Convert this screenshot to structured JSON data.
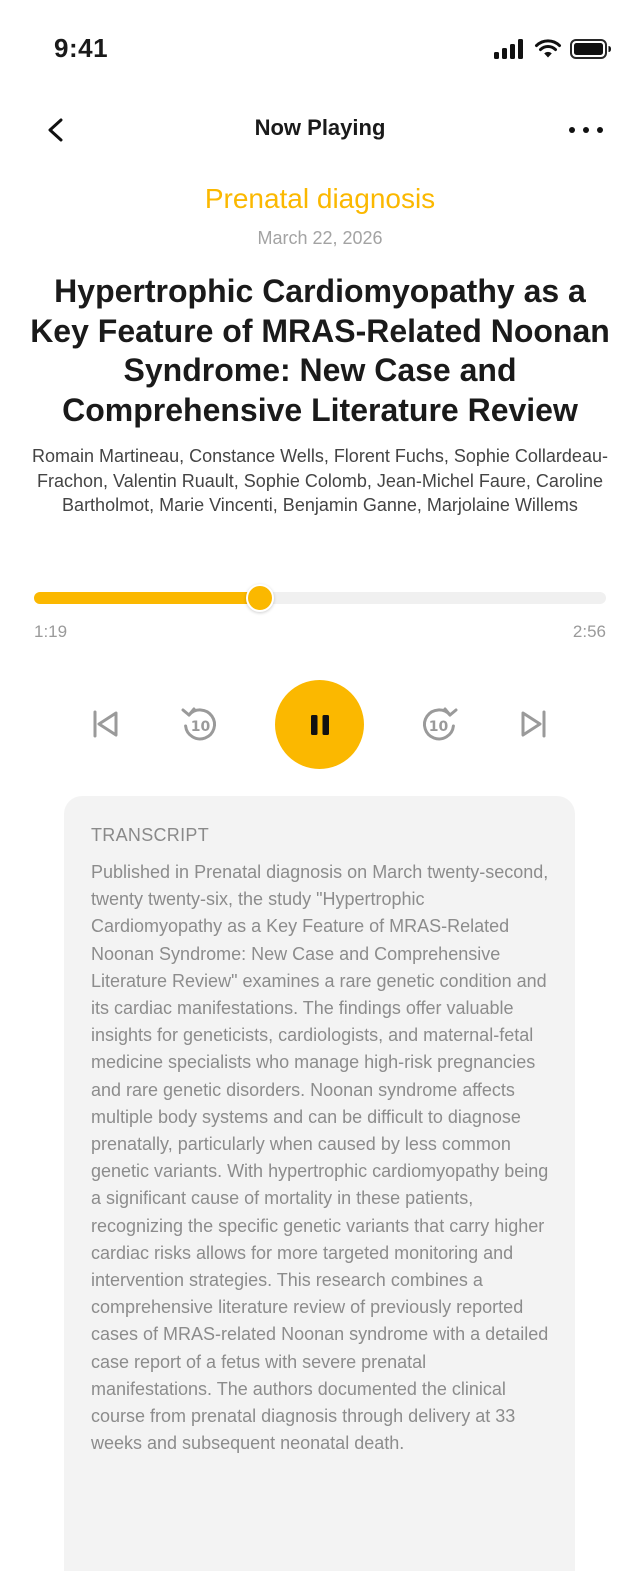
{
  "status_bar": {
    "time": "9:41"
  },
  "nav": {
    "title": "Now Playing"
  },
  "article": {
    "journal": "Prenatal diagnosis",
    "date": "March 22, 2026",
    "title": "Hypertrophic Cardiomyopathy as a Key Feature of MRAS-Related Noonan Syndrome: New Case and Comprehensive Literature Review",
    "authors": "Romain Martineau, Constance Wells, Florent Fuchs, Sophie Collardeau-Frachon, Valentin Ruault, Sophie Colomb, Jean-Michel Faure, Caroline Bartholmot, Marie Vincenti, Benjamin Ganne, Marjolaine Willems"
  },
  "player": {
    "elapsed": "1:19",
    "total": "2:56",
    "progress": 0.395,
    "state": "playing"
  },
  "transcript": {
    "label": "TRANSCRIPT",
    "text": "Published in Prenatal diagnosis on March twenty-second, twenty twenty-six, the study \"Hypertrophic Cardiomyopathy as a Key Feature of MRAS-Related Noonan Syndrome: New Case and Comprehensive Literature Review\" examines a rare genetic condition and its cardiac manifestations. The findings offer valuable insights for geneticists, cardiologists, and maternal-fetal medicine specialists who manage high-risk pregnancies and rare genetic disorders. Noonan syndrome affects multiple body systems and can be difficult to diagnose prenatally, particularly when caused by less common genetic variants. With hypertrophic cardiomyopathy being a significant cause of mortality in these patients, recognizing the specific genetic variants that carry higher cardiac risks allows for more targeted monitoring and intervention strategies. This research combines a comprehensive literature review of previously reported cases of MRAS-related Noonan syndrome with a detailed case report of a fetus with severe prenatal manifestations. The authors documented the clinical course from prenatal diagnosis through delivery at 33 weeks and subsequent neonatal death."
  },
  "colors": {
    "accent": "#FBB800",
    "text_primary": "#1a1a1a",
    "text_muted": "#a3a3a3",
    "card_bg": "#f3f3f3"
  },
  "icons": {
    "back": "chevron-left-icon",
    "more": "ellipsis-icon",
    "previous": "skip-back-icon",
    "rewind": "rewind-10-icon",
    "pause": "pause-icon",
    "forward": "forward-10-icon",
    "next": "skip-forward-icon"
  }
}
